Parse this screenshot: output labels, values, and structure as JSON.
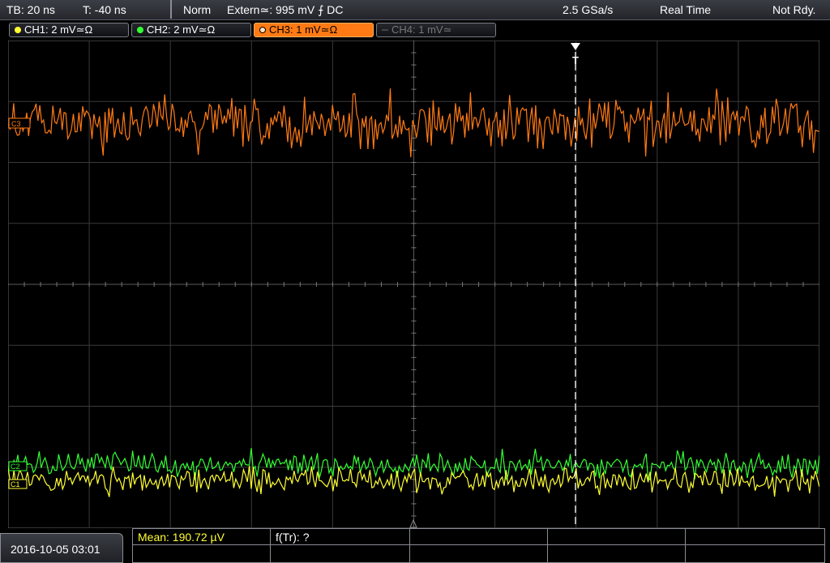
{
  "status": {
    "timebase": "TB: 20 ns",
    "trigger_time": "T: -40 ns",
    "mode": "Norm",
    "trigger_source": "Extern≃: 995 mV ⨍ DC",
    "sample_rate": "2.5 GSa/s",
    "acq_mode": "Real Time",
    "state": "Not Rdy."
  },
  "channels": [
    {
      "label": "CH1: 2 mV≃Ω",
      "color": "#ffff33",
      "state": "on"
    },
    {
      "label": "CH2: 2 mV≃Ω",
      "color": "#33ff33",
      "state": "on"
    },
    {
      "label": "CH3: 1 mV≃Ω",
      "color": "#ff7a14",
      "state": "selected"
    },
    {
      "label": "CH4: 1 mV≃",
      "color": "#777777",
      "state": "off"
    }
  ],
  "markers": {
    "ch3": "C3",
    "ch2": "C2",
    "ch1": "C1",
    "trigger": "T"
  },
  "footer": {
    "datetime": "2016-10-05 03:01",
    "mean": "Mean: 190.72 µV",
    "ftr": "f(Tr): ?"
  },
  "colors": {
    "ch1": "#ffff33",
    "ch2": "#33ff33",
    "ch3": "#ff7a14",
    "grid": "#3a3a3a",
    "grid_center": "#5a5a5a"
  }
}
